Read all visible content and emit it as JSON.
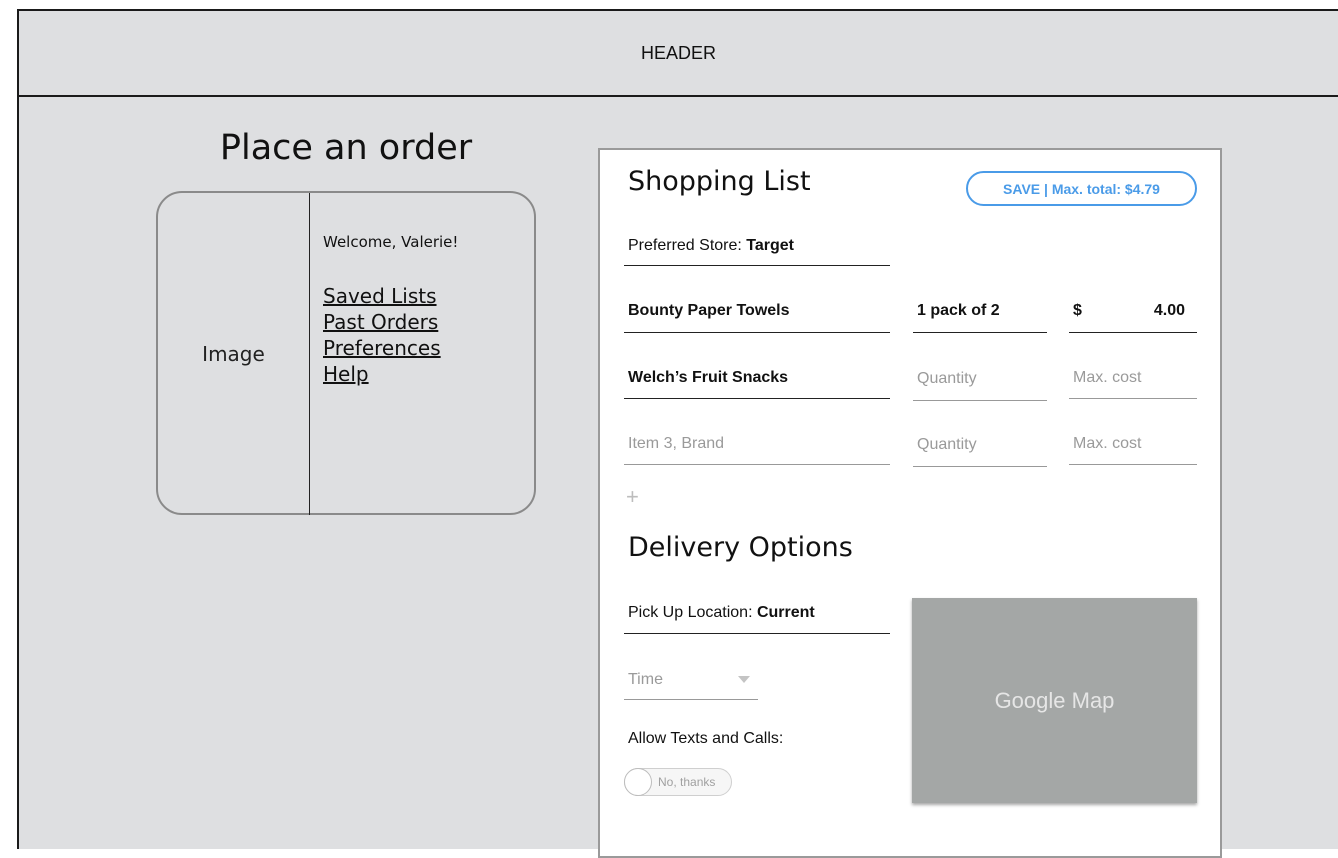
{
  "header": {
    "label": "HEADER"
  },
  "page_title": "Place an order",
  "profile": {
    "image_label": "Image",
    "welcome": "Welcome, Valerie!",
    "links": [
      "Saved Lists",
      "Past Orders",
      "Preferences",
      "Help"
    ]
  },
  "shopping_list": {
    "title": "Shopping List",
    "save_button": "SAVE | Max. total: $4.79",
    "preferred_store_label": "Preferred Store: ",
    "preferred_store_value": "Target",
    "items": [
      {
        "name": "Bounty Paper Towels",
        "quantity": "1 pack of 2",
        "currency": "$",
        "max_cost": "4.00"
      },
      {
        "name": "Welch’s Fruit Snacks",
        "quantity_placeholder": "Quantity",
        "max_cost_placeholder": "Max. cost"
      },
      {
        "name_placeholder": "Item 3, Brand",
        "quantity_placeholder": "Quantity",
        "max_cost_placeholder": "Max. cost"
      }
    ],
    "add_symbol": "+"
  },
  "delivery": {
    "title": "Delivery Options",
    "pickup_label": "Pick Up Location: ",
    "pickup_value": "Current",
    "time_placeholder": "Time",
    "allow_label": "Allow Texts and Calls:",
    "toggle_text": "No, thanks",
    "map_label": "Google Map"
  },
  "icons": {
    "time_dropdown": "chevron-down-icon",
    "add_item": "plus-icon"
  },
  "colors": {
    "accent": "#4a9be8",
    "background": "#dedfe1",
    "map": "#a4a7a6"
  }
}
